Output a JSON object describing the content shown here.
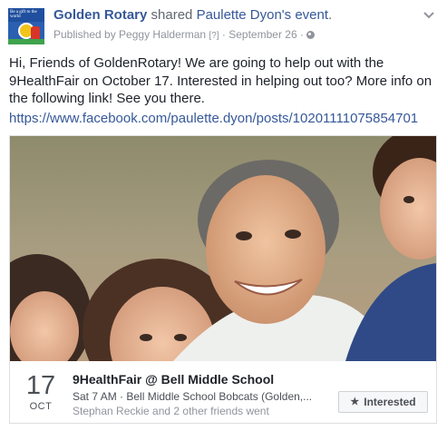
{
  "header": {
    "page_name": "Golden Rotary",
    "verb": " shared ",
    "event_owner": "Paulette Dyon",
    "event_link_suffix": "'s event",
    "period": ".",
    "published_by_prefix": "Published by ",
    "publisher": "Peggy Halderman",
    "help_marker": "[?]",
    "separator": " · ",
    "date": "September 26",
    "separator2": " · ",
    "avatar_text": "Be a gift to the world"
  },
  "post": {
    "message": "Hi, Friends of GoldenRotary! We are going to help out with the 9HealthFair on October 17. Interested in helping out too? More info on the following link! See you there.",
    "link": "https://www.facebook.com/paulette.dyon/posts/10201111075854701"
  },
  "event": {
    "day": "17",
    "month": "OCT",
    "title": "9HealthFair @ Bell Middle School",
    "meta": "Sat 7 AM · Bell Middle School Bobcats (Golden,...",
    "friends": "Stephan Reckie and 2 other friends went",
    "interested_label": "Interested",
    "interested_icon": "★"
  },
  "colors": {
    "link": "#365899",
    "text": "#1d2129",
    "muted": "#90949c"
  }
}
